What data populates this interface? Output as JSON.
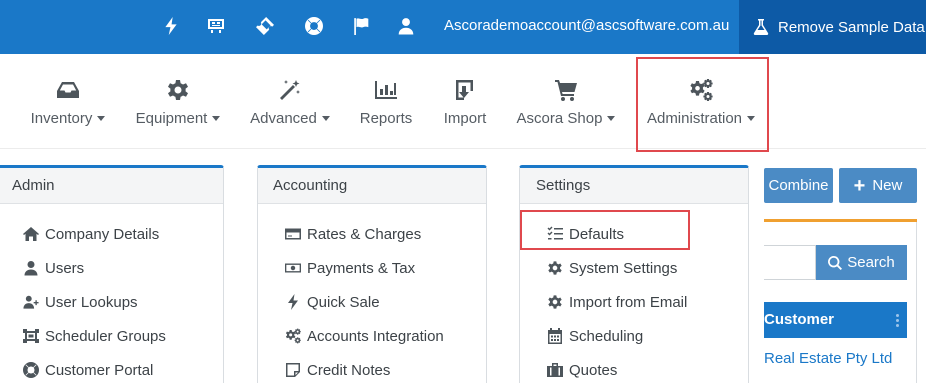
{
  "topbar": {
    "icons": [
      "bolt-icon",
      "board-icon",
      "ticket-icon",
      "lifebuoy-icon",
      "flag-icon",
      "user-icon"
    ],
    "email": "Ascorademoaccount@ascsoftware.com.au",
    "remove_sample_label": "Remove Sample Data",
    "remove_sample_icon": "flask-icon"
  },
  "nav": {
    "items": [
      {
        "label": "Inventory",
        "icon": "inbox-icon",
        "dropdown": true
      },
      {
        "label": "Equipment",
        "icon": "gear-icon",
        "dropdown": true
      },
      {
        "label": "Advanced",
        "icon": "magic-wand-icon",
        "dropdown": true
      },
      {
        "label": "Reports",
        "icon": "bar-chart-icon",
        "dropdown": false
      },
      {
        "label": "Import",
        "icon": "import-icon",
        "dropdown": false
      },
      {
        "label": "Ascora Shop",
        "icon": "cart-icon",
        "dropdown": true
      },
      {
        "label": "Administration",
        "icon": "gears-icon",
        "dropdown": true
      }
    ],
    "highlighted": "Administration"
  },
  "panels": [
    {
      "title": "Admin",
      "items": [
        {
          "label": "Company Details",
          "icon": "home-icon"
        },
        {
          "label": "Users",
          "icon": "user-icon"
        },
        {
          "label": "User Lookups",
          "icon": "user-plus-icon"
        },
        {
          "label": "Scheduler Groups",
          "icon": "group-icon"
        },
        {
          "label": "Customer Portal",
          "icon": "lifebuoy-icon"
        }
      ]
    },
    {
      "title": "Accounting",
      "items": [
        {
          "label": "Rates & Charges",
          "icon": "credit-card-icon"
        },
        {
          "label": "Payments & Tax",
          "icon": "money-icon"
        },
        {
          "label": "Quick Sale",
          "icon": "bolt-icon"
        },
        {
          "label": "Accounts Integration",
          "icon": "gears-icon"
        },
        {
          "label": "Credit Notes",
          "icon": "note-icon"
        }
      ]
    },
    {
      "title": "Settings",
      "items": [
        {
          "label": "Defaults",
          "icon": "checklist-icon"
        },
        {
          "label": "System Settings",
          "icon": "gear-icon"
        },
        {
          "label": "Import from Email",
          "icon": "gear-icon"
        },
        {
          "label": "Scheduling",
          "icon": "calendar-icon"
        },
        {
          "label": "Quotes",
          "icon": "briefcase-icon"
        }
      ]
    }
  ],
  "right": {
    "combine_label": "Combine",
    "new_label": "New",
    "search_label": "Search",
    "search_value": "",
    "table_header": "Customer",
    "first_row": "Real Estate Pty Ltd"
  },
  "colors": {
    "topbar": "#1a78c8",
    "remove_sample_bg": "#0d5aa6",
    "button": "#4b8bc5",
    "highlight": "#e0484d",
    "accent_orange": "#f0a030"
  }
}
